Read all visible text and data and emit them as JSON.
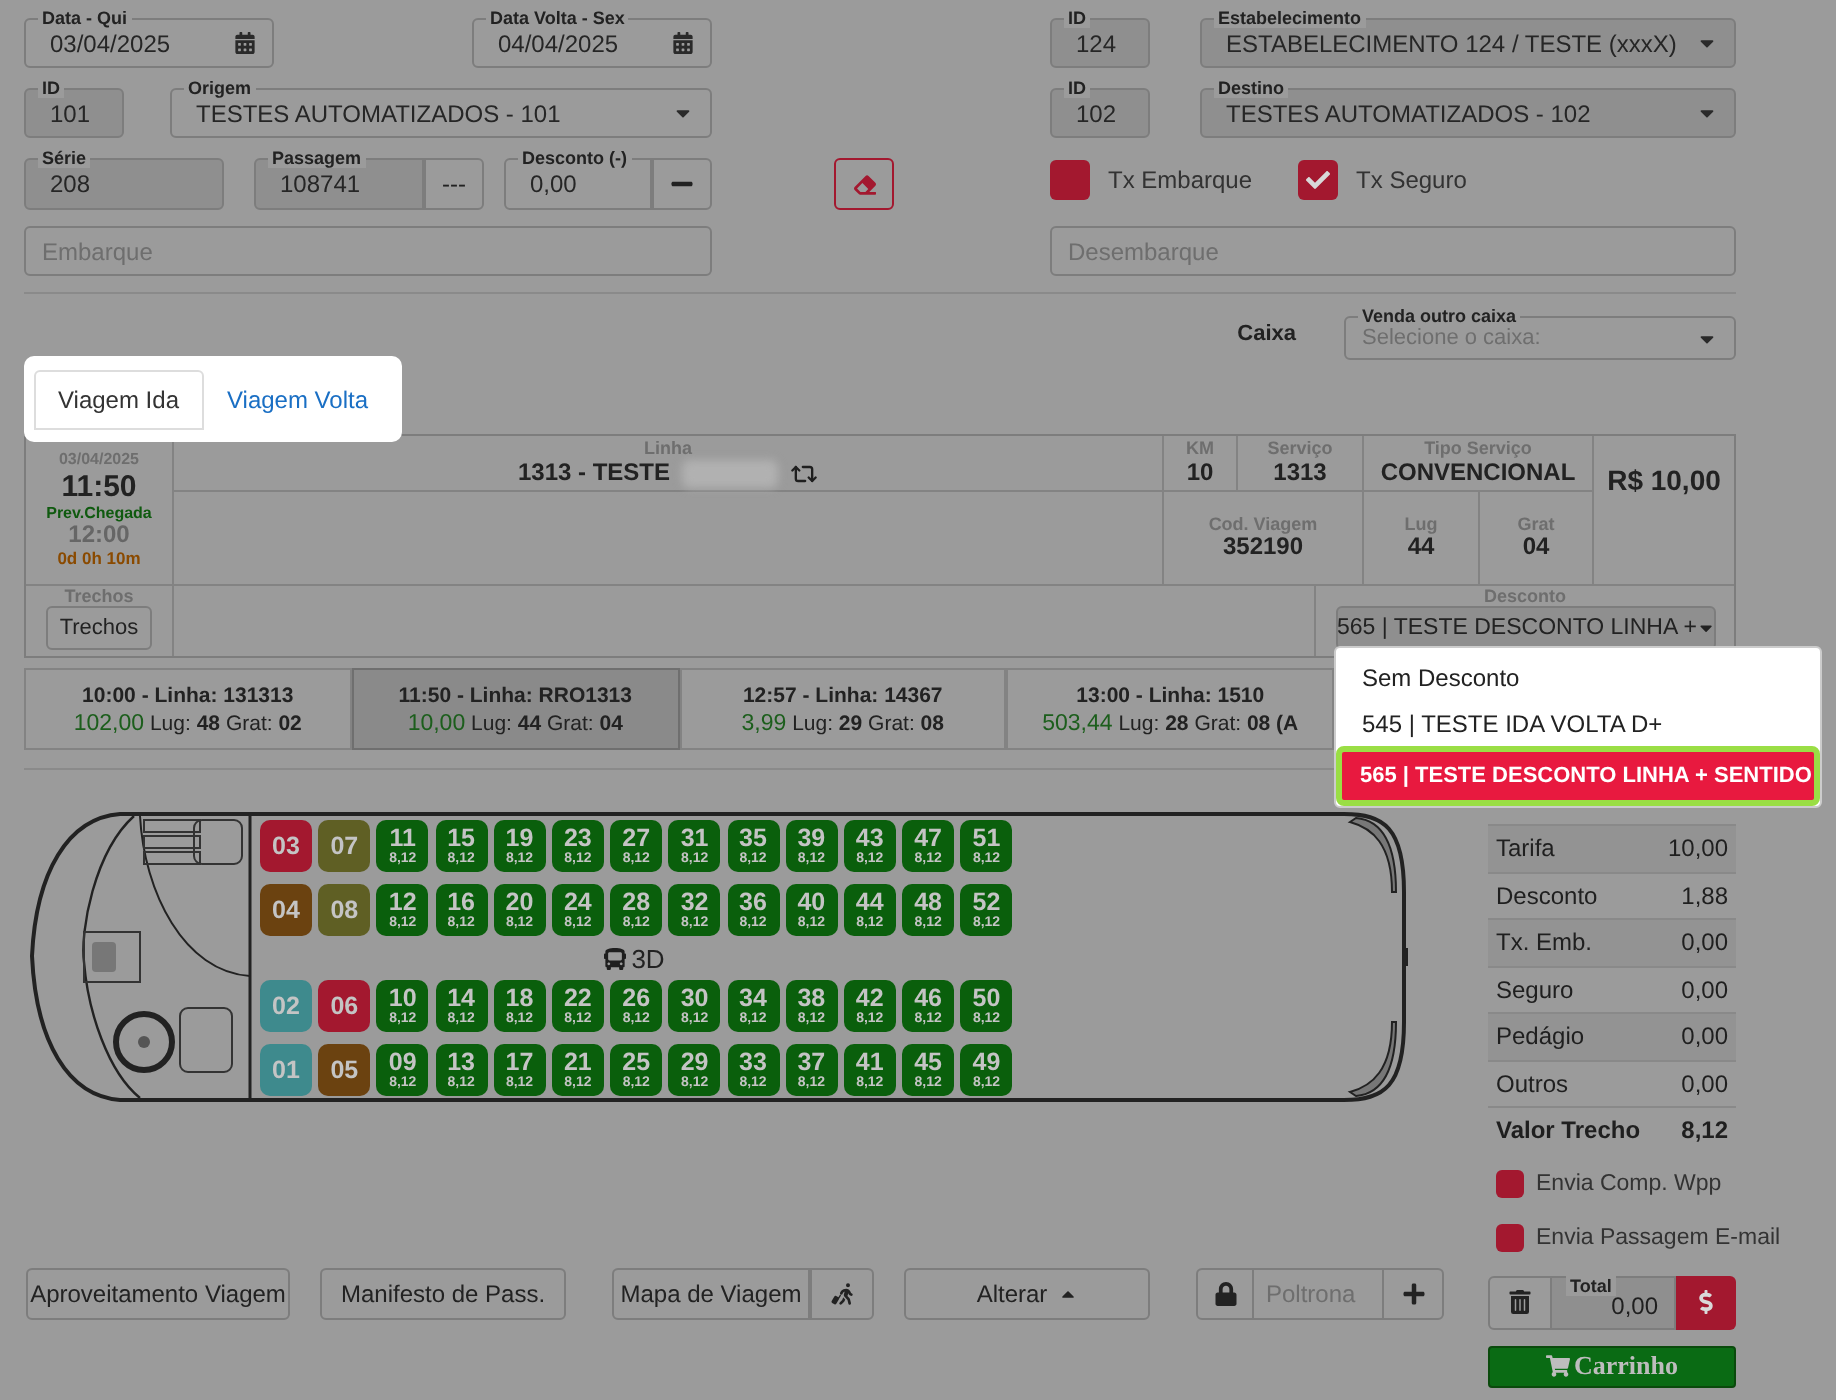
{
  "top": {
    "dates": [
      {
        "label": "Data - Qui",
        "value": "03/04/2025"
      },
      {
        "label": "Data Volta - Sex",
        "value": "04/04/2025"
      }
    ],
    "origin": {
      "id_label": "ID",
      "id": "101",
      "label": "Origem",
      "value": "TESTES AUTOMATIZADOS - 101"
    },
    "establishment": {
      "id_label": "ID",
      "id": "124",
      "label": "Estabelecimento",
      "value": "ESTABELECIMENTO 124 / TESTE (xxxX)"
    },
    "destination": {
      "id_label": "ID",
      "id": "102",
      "label": "Destino",
      "value": "TESTES AUTOMATIZADOS - 102"
    },
    "serie": {
      "label": "Série",
      "value": "208"
    },
    "ticket": {
      "label": "Passagem",
      "value": "108741",
      "button": "---"
    },
    "discount": {
      "label": "Desconto (-)",
      "value": "0,00"
    },
    "fees": [
      {
        "label": "Tx Embarque",
        "checked": false
      },
      {
        "label": "Tx Seguro",
        "checked": true
      }
    ],
    "boarding": {
      "placeholder": "Embarque"
    },
    "alighting": {
      "placeholder": "Desembarque"
    }
  },
  "cashier": {
    "label": "Caixa",
    "field_label": "Venda outro caixa",
    "placeholder": "Selecione o caixa:"
  },
  "tabs": [
    {
      "label": "Viagem Ida",
      "selected": true
    },
    {
      "label": "Viagem Volta",
      "selected": false
    }
  ],
  "trip": {
    "date": "03/04/2025",
    "departure": "11:50",
    "arrival_label": "Prev.Chegada",
    "arrival": "12:00",
    "duration": "0d 0h 10m",
    "line_label": "Linha",
    "line": "1313 - TESTE",
    "km_label": "KM",
    "km": "10",
    "service_label": "Serviço",
    "service": "1313",
    "service_type_label": "Tipo Serviço",
    "service_type": "CONVENCIONAL",
    "trip_code_label": "Cod. Viagem",
    "trip_code": "352190",
    "seats_label": "Lug",
    "seats": "44",
    "free_label": "Grat",
    "free": "04",
    "price": "R$ 10,00",
    "segments_label": "Trechos",
    "segments_button": "Trechos",
    "discount_label": "Desconto",
    "discount_value": "565 | TESTE DESCONTO LINHA +"
  },
  "trip_options": [
    {
      "title": "10:00 - Linha: 131313",
      "price": "102,00",
      "seats_label": "Lug:",
      "seats": "48",
      "free_label": "Grat:",
      "free": "02",
      "selected": false
    },
    {
      "title": "11:50 - Linha: RRO1313",
      "price": "10,00",
      "seats_label": "Lug:",
      "seats": "44",
      "free_label": "Grat:",
      "free": "04",
      "selected": true
    },
    {
      "title": "12:57 - Linha: 14367",
      "price": "3,99",
      "seats_label": "Lug:",
      "seats": "29",
      "free_label": "Grat:",
      "free": "08",
      "selected": false
    },
    {
      "title": "13:00 - Linha: 1510",
      "price": "503,44",
      "seats_label": "Lug:",
      "seats": "28",
      "free_label": "Grat:",
      "free": "08 (A",
      "selected": false
    }
  ],
  "discount_options": [
    {
      "label": "Sem Desconto",
      "selected": false
    },
    {
      "label": "545 | TESTE IDA VOLTA D+",
      "selected": false
    },
    {
      "label": "565 | TESTE DESCONTO LINHA + SENTIDO",
      "selected": true
    }
  ],
  "seat_map": {
    "deck": "3D",
    "rows": [
      [
        {
          "number": "03",
          "color": "#a3182f"
        },
        {
          "number": "07",
          "color": "#5f5f24"
        },
        {
          "number": "11",
          "price": "8,12",
          "color": "#0a5f0c"
        },
        {
          "number": "15",
          "price": "8,12",
          "color": "#0a5f0c"
        },
        {
          "number": "19",
          "price": "8,12",
          "color": "#0a5f0c"
        },
        {
          "number": "23",
          "price": "8,12",
          "color": "#0a5f0c"
        },
        {
          "number": "27",
          "price": "8,12",
          "color": "#0a5f0c"
        },
        {
          "number": "31",
          "price": "8,12",
          "color": "#0a5f0c"
        },
        {
          "number": "35",
          "price": "8,12",
          "color": "#0a5f0c"
        },
        {
          "number": "39",
          "price": "8,12",
          "color": "#0a5f0c"
        },
        {
          "number": "43",
          "price": "8,12",
          "color": "#0a5f0c"
        },
        {
          "number": "47",
          "price": "8,12",
          "color": "#0a5f0c"
        },
        {
          "number": "51",
          "price": "8,12",
          "color": "#0a5f0c"
        }
      ],
      [
        {
          "number": "04",
          "color": "#6b4210"
        },
        {
          "number": "08",
          "color": "#5f5f24"
        },
        {
          "number": "12",
          "price": "8,12",
          "color": "#0a5f0c"
        },
        {
          "number": "16",
          "price": "8,12",
          "color": "#0a5f0c"
        },
        {
          "number": "20",
          "price": "8,12",
          "color": "#0a5f0c"
        },
        {
          "number": "24",
          "price": "8,12",
          "color": "#0a5f0c"
        },
        {
          "number": "28",
          "price": "8,12",
          "color": "#0a5f0c"
        },
        {
          "number": "32",
          "price": "8,12",
          "color": "#0a5f0c"
        },
        {
          "number": "36",
          "price": "8,12",
          "color": "#0a5f0c"
        },
        {
          "number": "40",
          "price": "8,12",
          "color": "#0a5f0c"
        },
        {
          "number": "44",
          "price": "8,12",
          "color": "#0a5f0c"
        },
        {
          "number": "48",
          "price": "8,12",
          "color": "#0a5f0c"
        },
        {
          "number": "52",
          "price": "8,12",
          "color": "#0a5f0c"
        }
      ],
      [
        {
          "number": "02",
          "color": "#3e8a8d"
        },
        {
          "number": "06",
          "color": "#a3182f"
        },
        {
          "number": "10",
          "price": "8,12",
          "color": "#0a5f0c"
        },
        {
          "number": "14",
          "price": "8,12",
          "color": "#0a5f0c"
        },
        {
          "number": "18",
          "price": "8,12",
          "color": "#0a5f0c"
        },
        {
          "number": "22",
          "price": "8,12",
          "color": "#0a5f0c"
        },
        {
          "number": "26",
          "price": "8,12",
          "color": "#0a5f0c"
        },
        {
          "number": "30",
          "price": "8,12",
          "color": "#0a5f0c"
        },
        {
          "number": "34",
          "price": "8,12",
          "color": "#0a5f0c"
        },
        {
          "number": "38",
          "price": "8,12",
          "color": "#0a5f0c"
        },
        {
          "number": "42",
          "price": "8,12",
          "color": "#0a5f0c"
        },
        {
          "number": "46",
          "price": "8,12",
          "color": "#0a5f0c"
        },
        {
          "number": "50",
          "price": "8,12",
          "color": "#0a5f0c"
        }
      ],
      [
        {
          "number": "01",
          "color": "#3e8a8d"
        },
        {
          "number": "05",
          "color": "#6b4210"
        },
        {
          "number": "09",
          "price": "8,12",
          "color": "#0a5f0c"
        },
        {
          "number": "13",
          "price": "8,12",
          "color": "#0a5f0c"
        },
        {
          "number": "17",
          "price": "8,12",
          "color": "#0a5f0c"
        },
        {
          "number": "21",
          "price": "8,12",
          "color": "#0a5f0c"
        },
        {
          "number": "25",
          "price": "8,12",
          "color": "#0a5f0c"
        },
        {
          "number": "29",
          "price": "8,12",
          "color": "#0a5f0c"
        },
        {
          "number": "33",
          "price": "8,12",
          "color": "#0a5f0c"
        },
        {
          "number": "37",
          "price": "8,12",
          "color": "#0a5f0c"
        },
        {
          "number": "41",
          "price": "8,12",
          "color": "#0a5f0c"
        },
        {
          "number": "45",
          "price": "8,12",
          "color": "#0a5f0c"
        },
        {
          "number": "49",
          "price": "8,12",
          "color": "#0a5f0c"
        }
      ]
    ]
  },
  "summary": [
    {
      "label": "Tarifa",
      "value": "10,00"
    },
    {
      "label": "Desconto",
      "value": "1,88"
    },
    {
      "label": "Tx. Emb.",
      "value": "0,00"
    },
    {
      "label": "Seguro",
      "value": "0,00"
    },
    {
      "label": "Pedágio",
      "value": "0,00"
    },
    {
      "label": "Outros",
      "value": "0,00"
    }
  ],
  "summary_total": {
    "label": "Valor Trecho",
    "value": "8,12"
  },
  "send_options": [
    {
      "label": "Envia Comp. Wpp",
      "checked": false
    },
    {
      "label": "Envia Passagem E-mail",
      "checked": false
    }
  ],
  "actions": [
    {
      "label": "Aproveitamento Viagem",
      "kind": "plain"
    },
    {
      "label": "Manifesto de Pass.",
      "kind": "plain"
    },
    {
      "label": "Mapa de Viagem",
      "kind": "split"
    },
    {
      "label": "Alterar",
      "kind": "dropdown"
    }
  ],
  "seat_input": {
    "placeholder": "Poltrona"
  },
  "total": {
    "label": "Total",
    "value": "0,00"
  },
  "cart_button": "Carrinho"
}
